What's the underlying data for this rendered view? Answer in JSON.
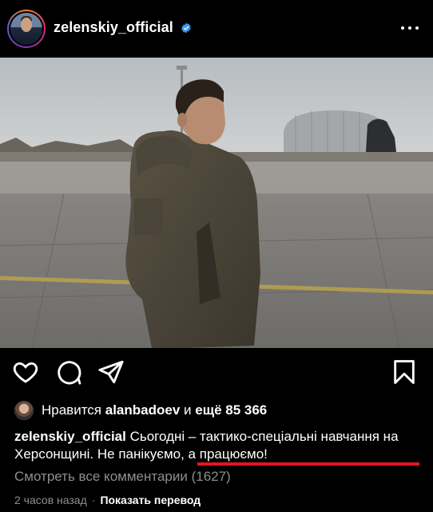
{
  "post": {
    "username": "zelenskiy_official",
    "verified_color": "#3897f0",
    "likes": {
      "prefix": "Нравится",
      "liker": "alanbadoev",
      "conjunction": "и",
      "more": "ещё 85 366"
    },
    "caption": {
      "username": "zelenskiy_official",
      "text_plain": "Сьогодні – тактико-спеціальні навчання на Херсонщині.",
      "text_highlight": "Не панікуємо, а працюємо!"
    },
    "comments_link": "Смотреть все комментарии (1627)",
    "time_ago": "2 часов назад",
    "separator": "·",
    "translate_label": "Показать перевод",
    "highlight_color": "#e3171b"
  },
  "icons": {
    "like": "heart-icon",
    "comment": "comment-icon",
    "share": "send-icon",
    "save": "bookmark-icon",
    "more": "more-icon",
    "verified": "verified-badge-icon"
  }
}
